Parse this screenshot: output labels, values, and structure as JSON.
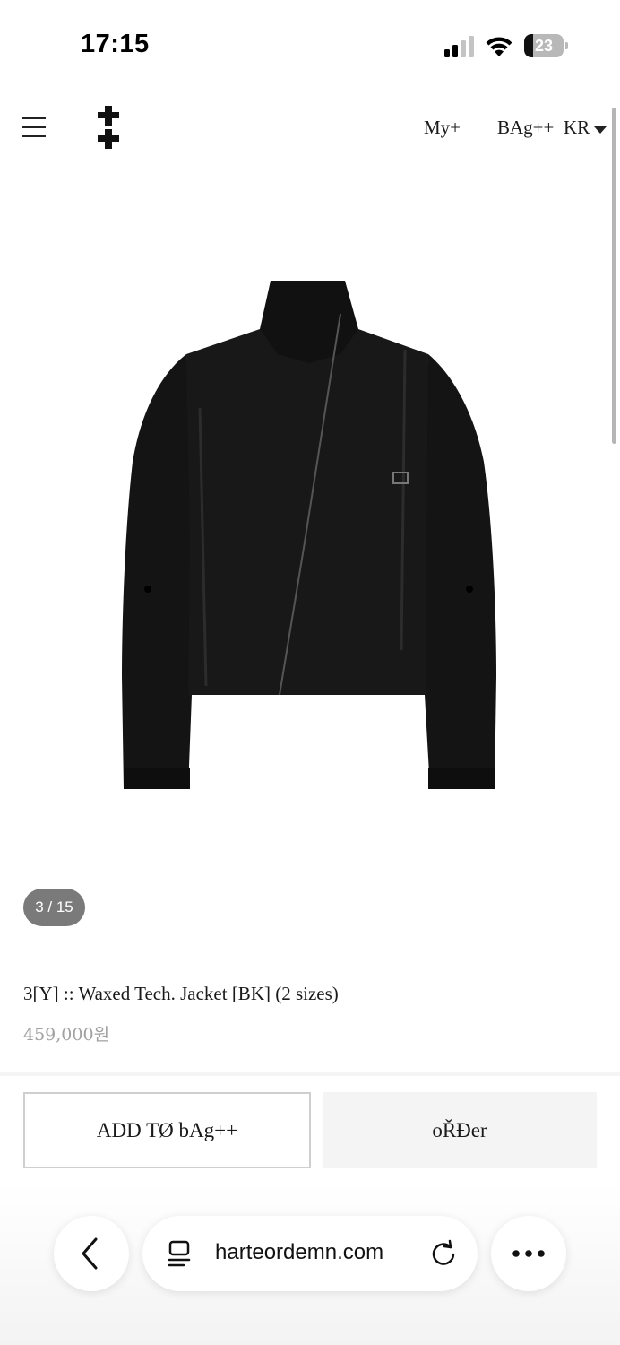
{
  "status_bar": {
    "time": "17:15",
    "battery_level": "23",
    "signal_bars_active": 2,
    "signal_bars_total": 4
  },
  "header": {
    "my_label": "My+",
    "bag_label": "BAg++",
    "lang_label": "KR"
  },
  "product": {
    "slide_counter": "3 / 15",
    "title": "3[Y] :: Waxed Tech. Jacket [BK] (2 sizes)",
    "price": "459,000원"
  },
  "actions": {
    "add_to_bag_label": "ADD TØ bAg++",
    "order_label": "oŘĐer"
  },
  "browser": {
    "url": "harteordemn.com"
  },
  "colors": {
    "text": "#1a1a1a",
    "price": "#a0a0a0",
    "counter_bg": "#7a7a7a",
    "order_bg": "#f4f4f4",
    "jacket": "#141414"
  }
}
